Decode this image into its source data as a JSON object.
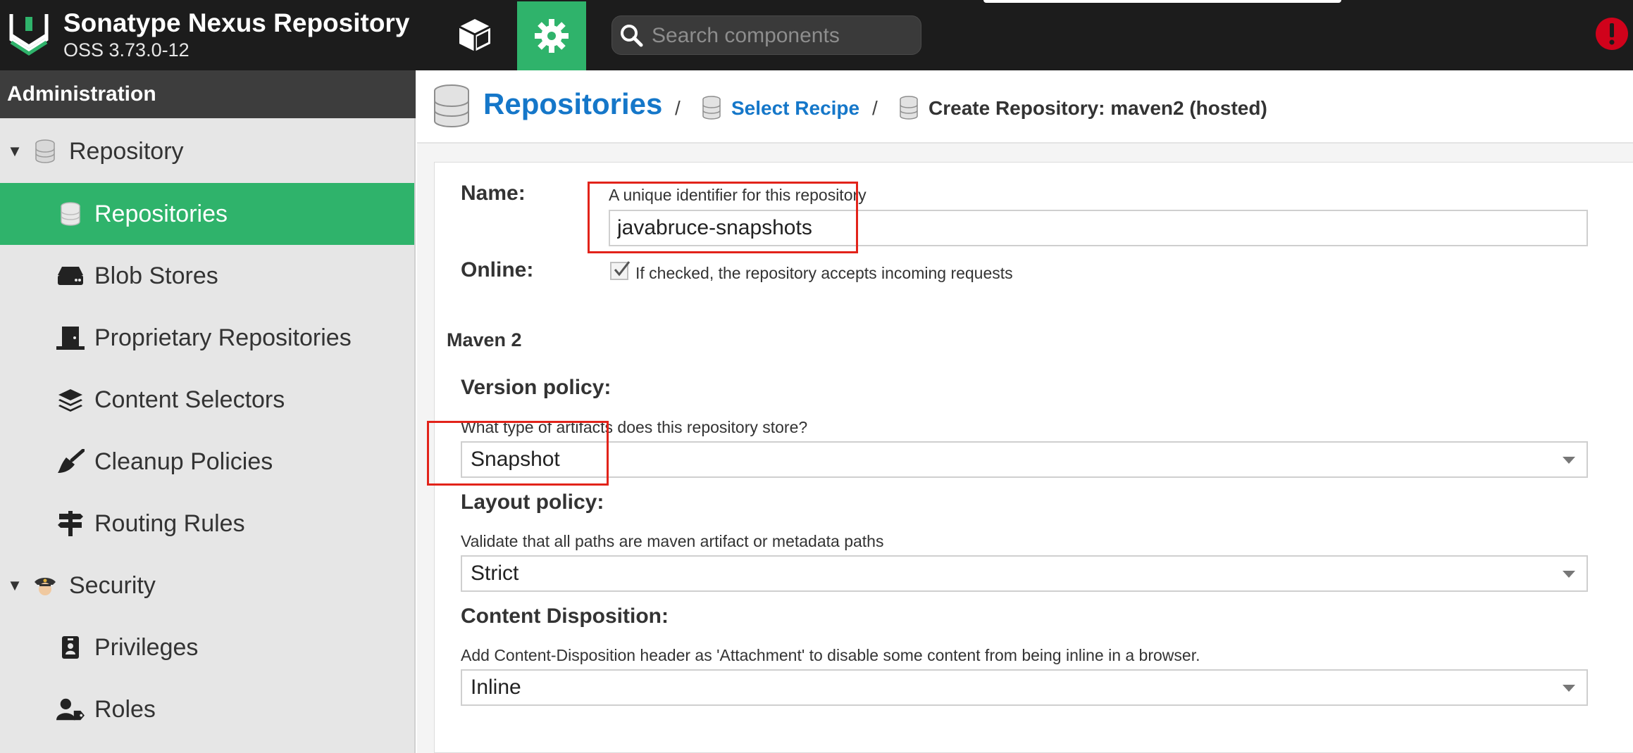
{
  "app": {
    "brand_name": "Sonatype Nexus Repository",
    "brand_version": "OSS 3.73.0-12",
    "accent_color": "#2fb36b",
    "link_color": "#1577c9",
    "alert_color": "#d0021b"
  },
  "header": {
    "nav": [
      {
        "id": "browse",
        "icon": "cube-icon",
        "active": false
      },
      {
        "id": "administration",
        "icon": "gear-icon",
        "active": true
      }
    ],
    "search": {
      "placeholder": "Search components",
      "value": ""
    },
    "alert_icon": "exclamation-circle-icon"
  },
  "sidebar": {
    "title": "Administration",
    "items": [
      {
        "label": "Repository",
        "icon": "database-icon",
        "expanded": true,
        "level": 1
      },
      {
        "label": "Repositories",
        "icon": "database-icon",
        "active": true,
        "level": 2
      },
      {
        "label": "Blob Stores",
        "icon": "hard-drive-icon",
        "level": 2
      },
      {
        "label": "Proprietary Repositories",
        "icon": "door-icon",
        "level": 2
      },
      {
        "label": "Content Selectors",
        "icon": "layers-icon",
        "level": 2
      },
      {
        "label": "Cleanup Policies",
        "icon": "broom-icon",
        "level": 2
      },
      {
        "label": "Routing Rules",
        "icon": "signpost-icon",
        "level": 2
      },
      {
        "label": "Security",
        "icon": "police-icon",
        "expanded": true,
        "level": 1
      },
      {
        "label": "Privileges",
        "icon": "id-badge-icon",
        "level": 2
      },
      {
        "label": "Roles",
        "icon": "user-tag-icon",
        "level": 2
      }
    ]
  },
  "breadcrumb": {
    "title": "Repositories",
    "separator": "/",
    "step": "Select Recipe",
    "current": "Create Repository: maven2 (hosted)"
  },
  "form": {
    "name": {
      "label": "Name:",
      "help": "A unique identifier for this repository",
      "value": "javabruce-snapshots"
    },
    "online": {
      "label": "Online:",
      "checked": true,
      "help": "If checked, the repository accepts incoming requests"
    },
    "section": "Maven 2",
    "version_policy": {
      "label": "Version policy:",
      "help": "What type of artifacts does this repository store?",
      "value": "Snapshot"
    },
    "layout_policy": {
      "label": "Layout policy:",
      "help": "Validate that all paths are maven artifact or metadata paths",
      "value": "Strict"
    },
    "content_disposition": {
      "label": "Content Disposition:",
      "help": "Add Content-Disposition header as 'Attachment' to disable some content from being inline in a browser.",
      "value": "Inline"
    }
  },
  "annotations": {
    "highlight_color": "#e2231a"
  }
}
